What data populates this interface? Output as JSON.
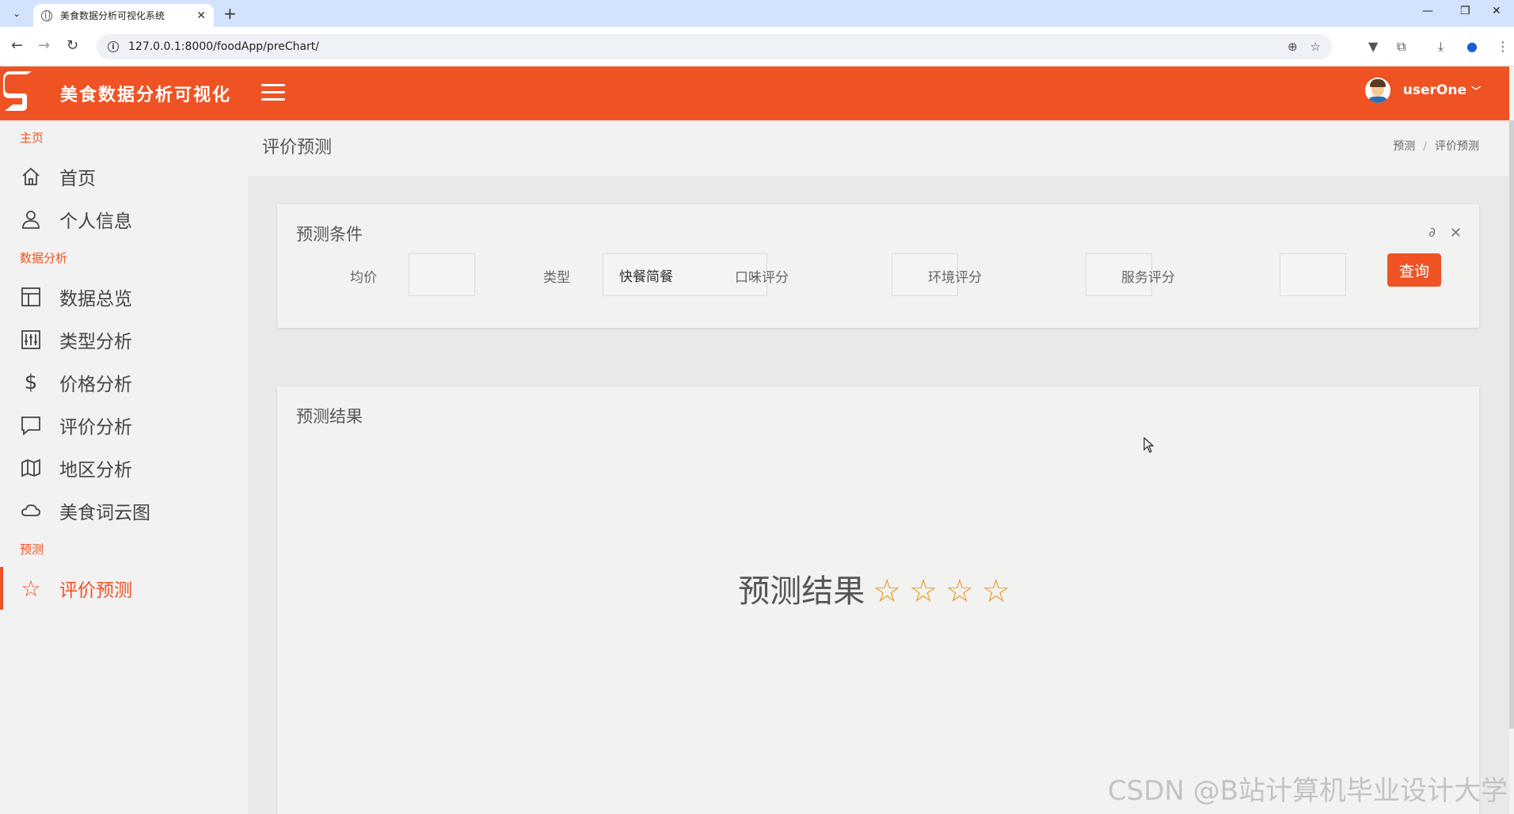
{
  "browser": {
    "tab_title": "美食数据分析可视化系统",
    "url": "127.0.0.1:8000/foodApp/preChart/"
  },
  "header": {
    "app_title": "美食数据分析可视化",
    "username": "userOne",
    "brand_color": "#ef5323"
  },
  "sidebar": {
    "sections": [
      {
        "label": "主页",
        "items": [
          {
            "label": "首页",
            "icon": "home-icon"
          },
          {
            "label": "个人信息",
            "icon": "user-icon"
          }
        ]
      },
      {
        "label": "数据分析",
        "items": [
          {
            "label": "数据总览",
            "icon": "layout-icon"
          },
          {
            "label": "类型分析",
            "icon": "sliders-icon"
          },
          {
            "label": "价格分析",
            "icon": "dollar-icon"
          },
          {
            "label": "评价分析",
            "icon": "message-icon"
          },
          {
            "label": "地区分析",
            "icon": "map-icon"
          },
          {
            "label": "美食词云图",
            "icon": "cloud-icon"
          }
        ]
      },
      {
        "label": "预测",
        "items": [
          {
            "label": "评价预测",
            "icon": "star-icon",
            "active": true
          }
        ]
      }
    ]
  },
  "page": {
    "title": "评价预测",
    "breadcrumb": [
      "预测",
      "评价预测"
    ]
  },
  "conditions": {
    "title": "预测条件",
    "avg_price_label": "均价",
    "avg_price_value": "",
    "type_label": "类型",
    "type_selected": "快餐简餐",
    "taste_label": "口味评分",
    "taste_value": "",
    "env_label": "环境评分",
    "env_value": "",
    "service_label": "服务评分",
    "service_value": "",
    "query_label": "查询"
  },
  "result": {
    "title": "预测结果",
    "text": "预测结果",
    "stars": "☆☆☆☆",
    "star_count": 4,
    "star_color": "#e89a1f"
  },
  "watermark": "CSDN @B站计算机毕业设计大学"
}
